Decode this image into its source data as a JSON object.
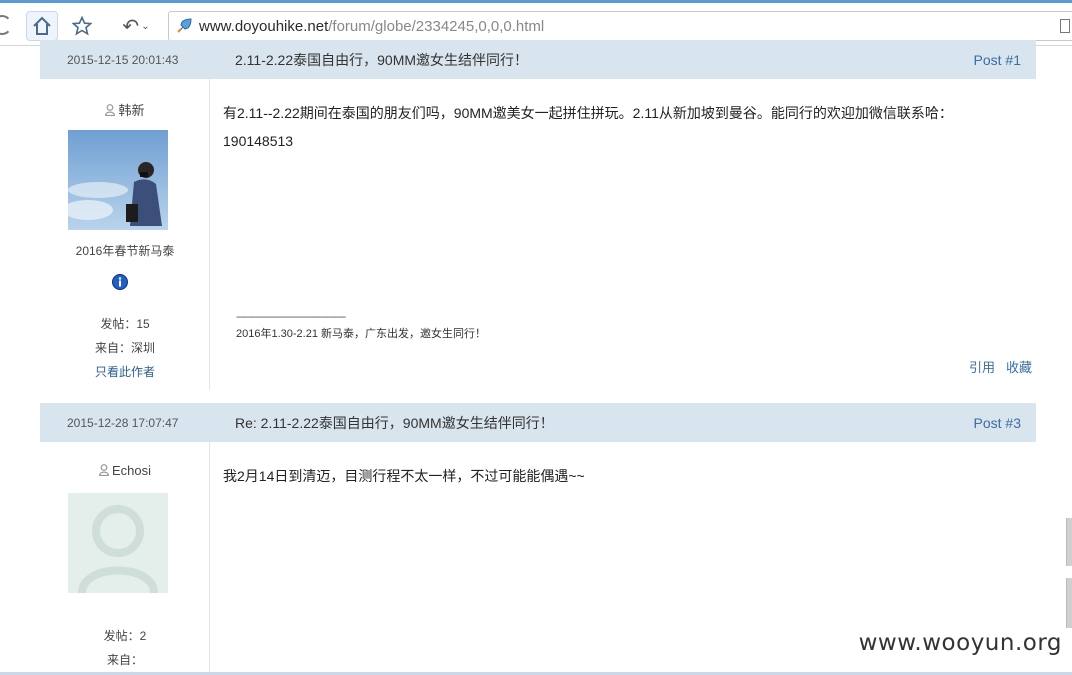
{
  "browser": {
    "url_domain": "www.doyouhike.net",
    "url_path": "/forum/globe/2334245,0,0,0.html"
  },
  "posts": [
    {
      "date": "2015-12-15 20:01:43",
      "title": "2.11-2.22泰国自由行，90MM邀女生结伴同行！",
      "post_no": "Post #1",
      "user": {
        "name": "韩新",
        "title": "2016年春节新马泰",
        "posts_label": "发帖：15",
        "from_label": "来自：深圳",
        "only_author": "只看此作者"
      },
      "body_line1": "有2.11--2.22期间在泰国的朋友们吗，90MM邀美女一起拼住拼玩。2.11从新加坡到曼谷。能同行的欢迎加微信联系哈：",
      "body_line2": "190148513",
      "signature_divider": "-----------------------------------------",
      "signature": "2016年1.30-2.21 新马泰，广东出发，邀女生同行！",
      "quote": "引用",
      "favorite": "收藏"
    },
    {
      "date": "2015-12-28 17:07:47",
      "title": "Re: 2.11-2.22泰国自由行，90MM邀女生结伴同行！",
      "post_no": "Post #3",
      "user": {
        "name": "Echosi",
        "posts_label": "发帖：2",
        "from_label": "来自："
      },
      "body_line1": "我2月14日到清迈，目测行程不太一样，不过可能能偶遇~~"
    }
  ],
  "watermark": "www.wooyun.org",
  "colors": {
    "header_bg": "#d9e5ee",
    "link": "#3a6da3",
    "browser_accent": "#5b9bd5"
  }
}
